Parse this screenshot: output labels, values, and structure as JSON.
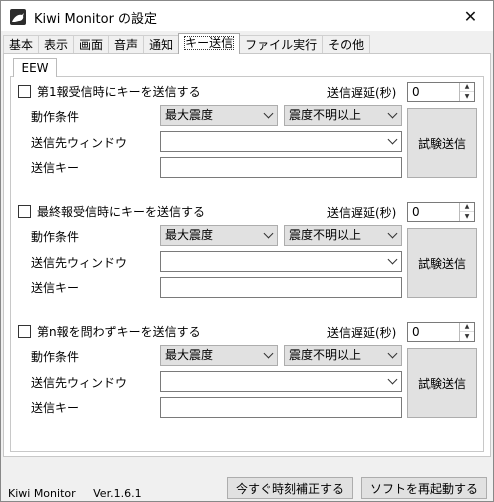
{
  "window": {
    "title": "Kiwi Monitor の設定",
    "close_glyph": "✕"
  },
  "tabs": [
    "基本",
    "表示",
    "画面",
    "音声",
    "通知",
    "キー送信",
    "ファイル実行",
    "その他"
  ],
  "active_tab": "キー送信",
  "subtab": "EEW",
  "sections": [
    {
      "checkbox_label": "第1報受信時にキーを送信する",
      "delay_label": "送信遅延(秒)",
      "delay_value": "0",
      "condition_label": "動作条件",
      "condition_select1": "最大震度",
      "condition_select2": "震度不明以上",
      "window_label": "送信先ウィンドウ",
      "window_value": "",
      "key_label": "送信キー",
      "key_value": "",
      "test_button": "試験送信"
    },
    {
      "checkbox_label": "最終報受信時にキーを送信する",
      "delay_label": "送信遅延(秒)",
      "delay_value": "0",
      "condition_label": "動作条件",
      "condition_select1": "最大震度",
      "condition_select2": "震度不明以上",
      "window_label": "送信先ウィンドウ",
      "window_value": "",
      "key_label": "送信キー",
      "key_value": "",
      "test_button": "試験送信"
    },
    {
      "checkbox_label": "第n報を問わずキーを送信する",
      "delay_label": "送信遅延(秒)",
      "delay_value": "0",
      "condition_label": "動作条件",
      "condition_select1": "最大震度",
      "condition_select2": "震度不明以上",
      "window_label": "送信先ウィンドウ",
      "window_value": "",
      "key_label": "送信キー",
      "key_value": "",
      "test_button": "試験送信"
    }
  ],
  "footer": {
    "app_name": "Kiwi Monitor",
    "version": "Ver.1.6.1",
    "sync_button": "今すぐ時刻補正する",
    "restart_button": "ソフトを再起動する"
  }
}
